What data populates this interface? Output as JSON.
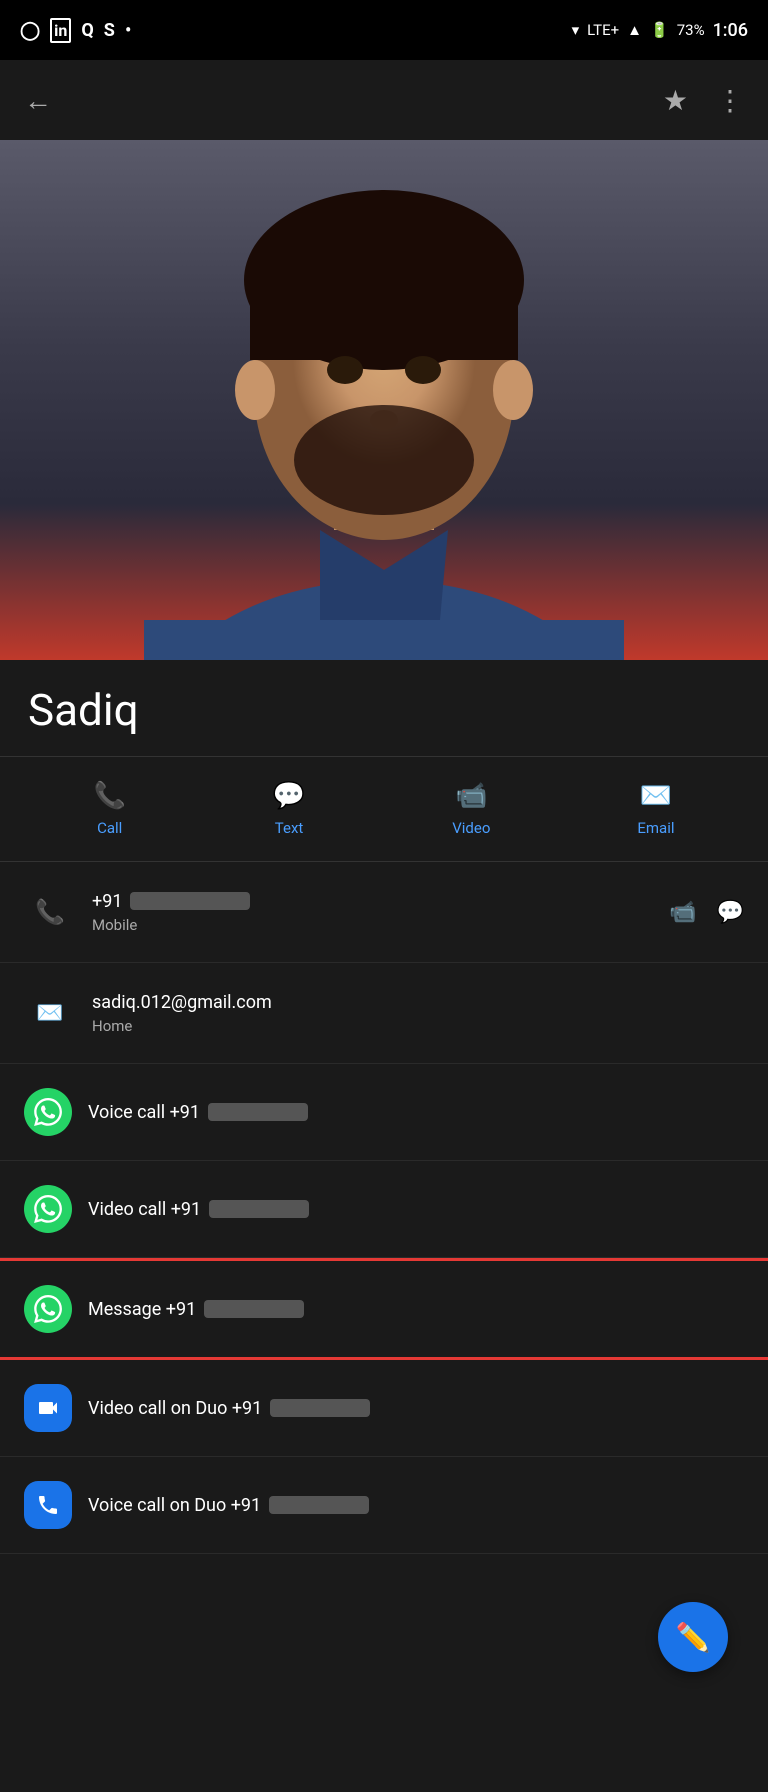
{
  "statusBar": {
    "time": "1:06",
    "battery": "73%",
    "network": "LTE+",
    "icons": [
      "facebook",
      "linkedin",
      "quora",
      "scribd",
      "dot"
    ]
  },
  "contact": {
    "name": "Sadiq",
    "phone": "+91",
    "phoneLabel": "Mobile",
    "email": "sadiq.012@gmail.com",
    "emailLabel": "Home"
  },
  "actions": {
    "call": "Call",
    "text": "Text",
    "video": "Video",
    "email": "Email"
  },
  "listItems": {
    "voiceCallLabel": "Voice call +91",
    "videoCallLabel": "Video call +91",
    "messageLabel": "Message +91",
    "duoVideoLabel": "Video call on Duo +91",
    "duoVoiceLabel": "Voice call on Duo +91"
  },
  "fab": {
    "icon": "edit"
  }
}
